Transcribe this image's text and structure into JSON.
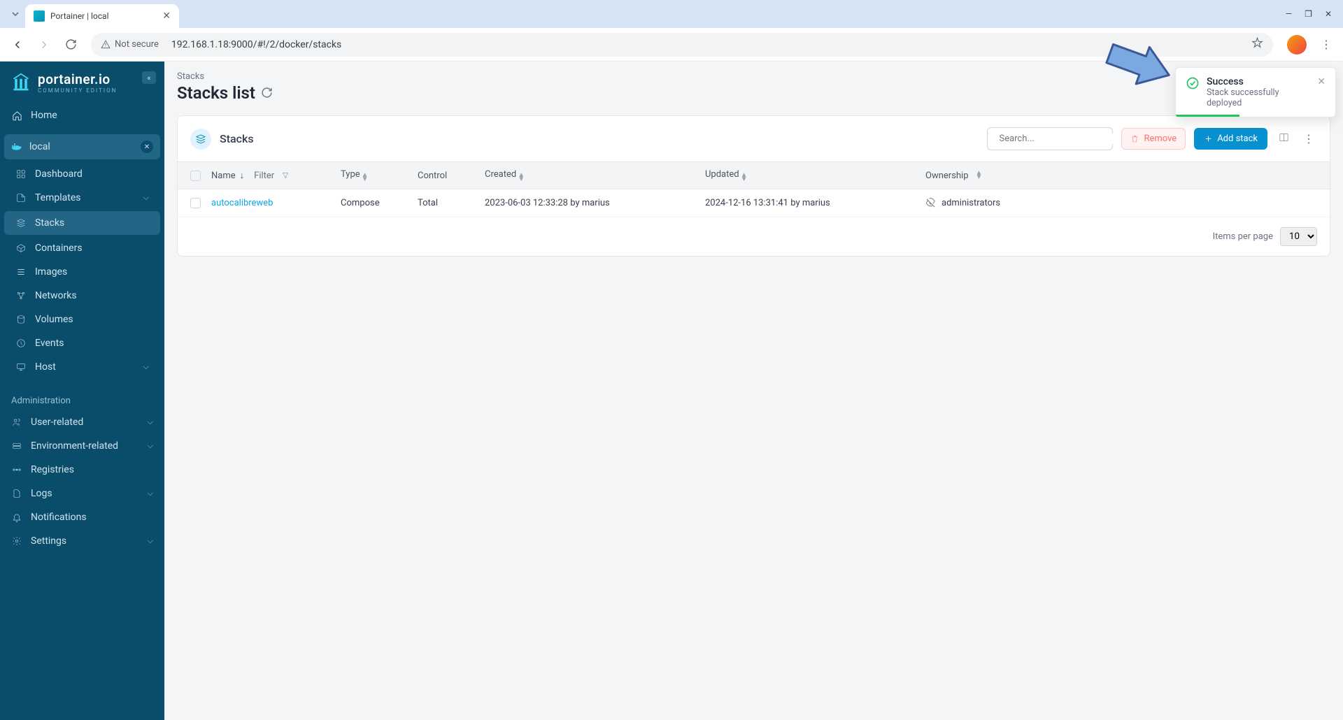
{
  "browser": {
    "tab_title": "Portainer | local",
    "not_secure": "Not secure",
    "url": "192.168.1.18:9000/#!/2/docker/stacks"
  },
  "logo": {
    "main": "portainer.io",
    "sub": "COMMUNITY EDITION"
  },
  "nav": {
    "home": "Home",
    "env_name": "local",
    "dashboard": "Dashboard",
    "templates": "Templates",
    "stacks": "Stacks",
    "containers": "Containers",
    "images": "Images",
    "networks": "Networks",
    "volumes": "Volumes",
    "events": "Events",
    "host": "Host",
    "admin_header": "Administration",
    "user_related": "User-related",
    "env_related": "Environment-related",
    "registries": "Registries",
    "logs": "Logs",
    "notifications": "Notifications",
    "settings": "Settings"
  },
  "page": {
    "breadcrumb": "Stacks",
    "title": "Stacks list",
    "panel_title": "Stacks",
    "search_placeholder": "Search...",
    "remove_label": "Remove",
    "add_label": "Add stack",
    "items_per_page": "Items per page",
    "page_size": "10"
  },
  "columns": {
    "name": "Name",
    "filter": "Filter",
    "type": "Type",
    "control": "Control",
    "created": "Created",
    "updated": "Updated",
    "ownership": "Ownership"
  },
  "rows": [
    {
      "name": "autocalibreweb",
      "type": "Compose",
      "control": "Total",
      "created": "2023-06-03 12:33:28 by marius",
      "updated": "2024-12-16 13:31:41 by marius",
      "ownership": "administrators"
    }
  ],
  "toast": {
    "title": "Success",
    "message": "Stack successfully deployed"
  }
}
